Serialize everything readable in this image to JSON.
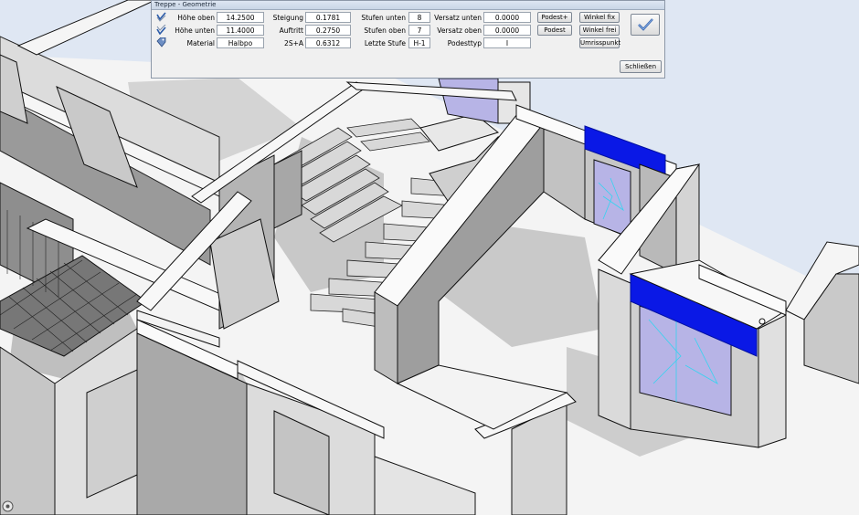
{
  "dialog": {
    "title": "Treppe - Geometrie",
    "hoehe_oben_label": "Höhe oben",
    "hoehe_oben_value": "14.2500",
    "hoehe_unten_label": "Höhe unten",
    "hoehe_unten_value": "11.4000",
    "material_label": "Material",
    "material_value": "Halbpo",
    "steigung_label": "Steigung",
    "steigung_value": "0.1781",
    "auftritt_label": "Auftritt",
    "auftritt_value": "0.2750",
    "schrittmass_label": "2S+A",
    "schrittmass_value": "0.6312",
    "stufen_unten_label": "Stufen unten",
    "stufen_unten_value": "8",
    "stufen_oben_label": "Stufen oben",
    "stufen_oben_value": "7",
    "letzte_stufe_label": "Letzte Stufe",
    "letzte_stufe_value": "H-1",
    "versatz_unten_label": "Versatz unten",
    "versatz_unten_value": "0.0000",
    "versatz_oben_label": "Versatz oben",
    "versatz_oben_value": "0.0000",
    "podesttyp_label": "Podesttyp",
    "podesttyp_value": "I",
    "podest_plus_label": "Podest+",
    "podest_label": "Podest",
    "winkel_fix_label": "Winkel fix",
    "winkel_frei_label": "Winkel frei",
    "umrisspunkt_label": "Umrisspunkt",
    "close_label": "Schließen"
  },
  "icons": {
    "row1": "stair-height-icon",
    "row2": "stair-height-bottom-icon",
    "row3": "material-tag-icon",
    "confirm": "checkmark-icon",
    "viewer": "view-navigation-icon"
  },
  "colors": {
    "sky": "#dfe7f3",
    "wall_light": "#e6e6e6",
    "wall_shade": "#b8b8b8",
    "floor": "#f2f2f2",
    "accent_blue": "#0a18e6",
    "glass": "#b7b4e6"
  }
}
